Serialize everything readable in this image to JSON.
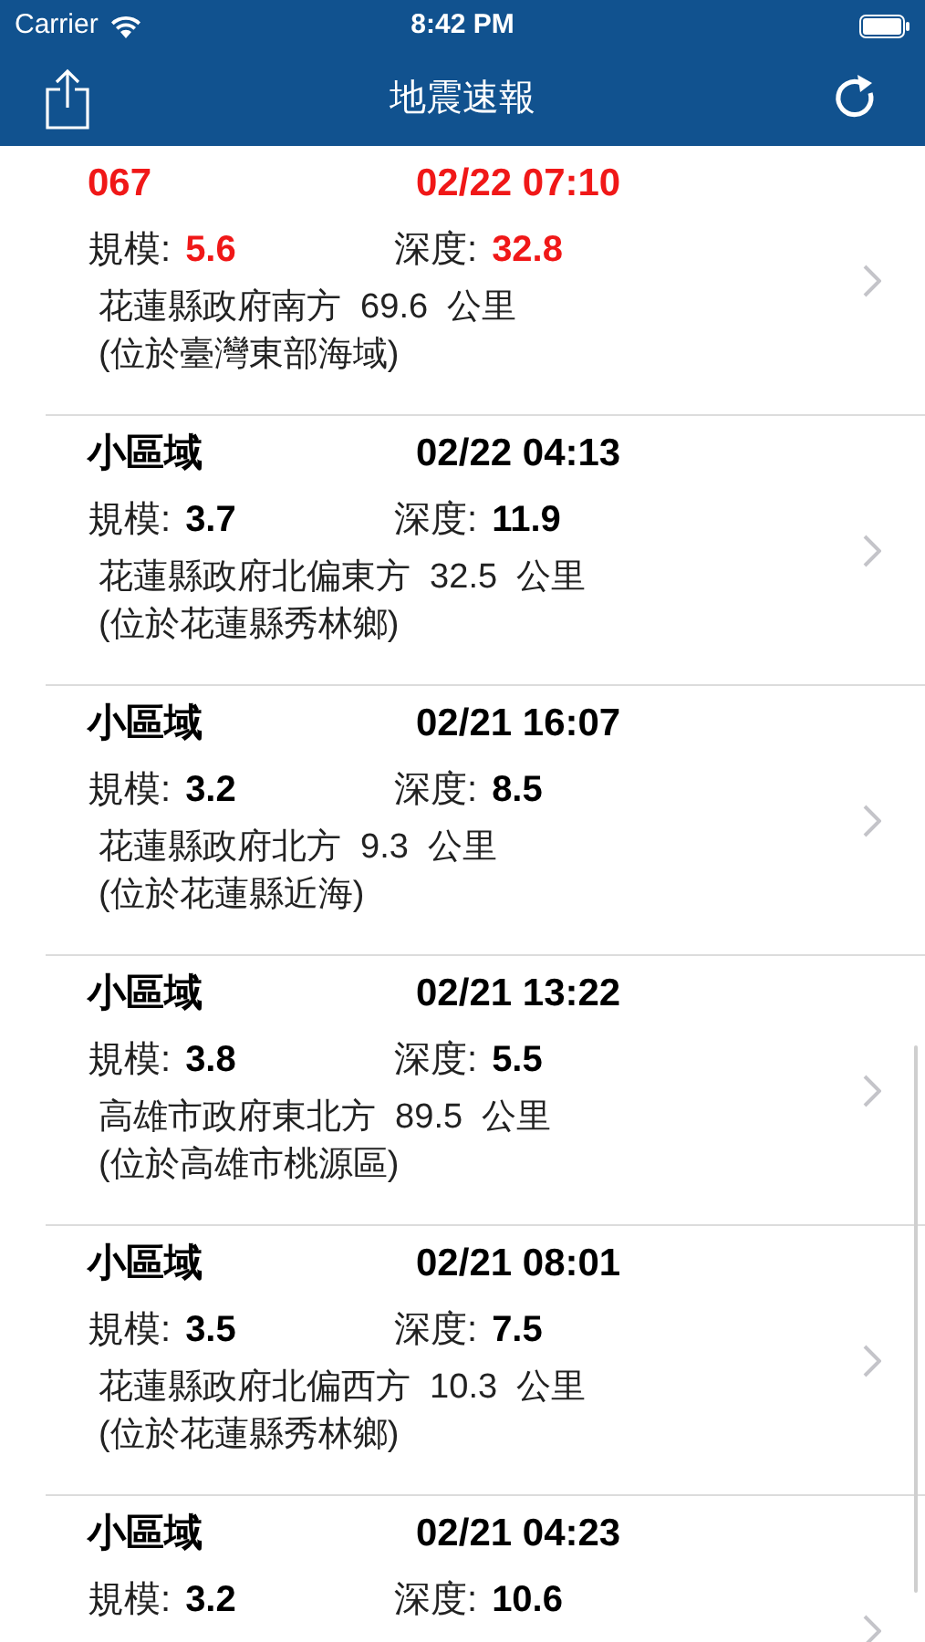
{
  "status_bar": {
    "carrier": "Carrier",
    "time": "8:42 PM"
  },
  "nav_bar": {
    "title": "地震速報"
  },
  "quakes": [
    {
      "label": "067",
      "time": "02/22 07:10",
      "magnitude_label": "規模:",
      "magnitude": "5.6",
      "depth_label": "深度:",
      "depth": "32.8",
      "location": "花蓮縣政府南方  69.6  公里",
      "area": "(位於臺灣東部海域)",
      "alert": true
    },
    {
      "label": "小區域",
      "time": "02/22 04:13",
      "magnitude_label": "規模:",
      "magnitude": "3.7",
      "depth_label": "深度:",
      "depth": "11.9",
      "location": "花蓮縣政府北偏東方  32.5  公里",
      "area": "(位於花蓮縣秀林鄉)",
      "alert": false
    },
    {
      "label": "小區域",
      "time": "02/21 16:07",
      "magnitude_label": "規模:",
      "magnitude": "3.2",
      "depth_label": "深度:",
      "depth": "8.5",
      "location": "花蓮縣政府北方  9.3  公里",
      "area": "(位於花蓮縣近海)",
      "alert": false
    },
    {
      "label": "小區域",
      "time": "02/21 13:22",
      "magnitude_label": "規模:",
      "magnitude": "3.8",
      "depth_label": "深度:",
      "depth": "5.5",
      "location": "高雄市政府東北方  89.5  公里",
      "area": "(位於高雄市桃源區)",
      "alert": false
    },
    {
      "label": "小區域",
      "time": "02/21 08:01",
      "magnitude_label": "規模:",
      "magnitude": "3.5",
      "depth_label": "深度:",
      "depth": "7.5",
      "location": "花蓮縣政府北偏西方  10.3  公里",
      "area": "(位於花蓮縣秀林鄉)",
      "alert": false
    },
    {
      "label": "小區域",
      "time": "02/21 04:23",
      "magnitude_label": "規模:",
      "magnitude": "3.2",
      "depth_label": "深度:",
      "depth": "10.6",
      "alert": false
    }
  ]
}
